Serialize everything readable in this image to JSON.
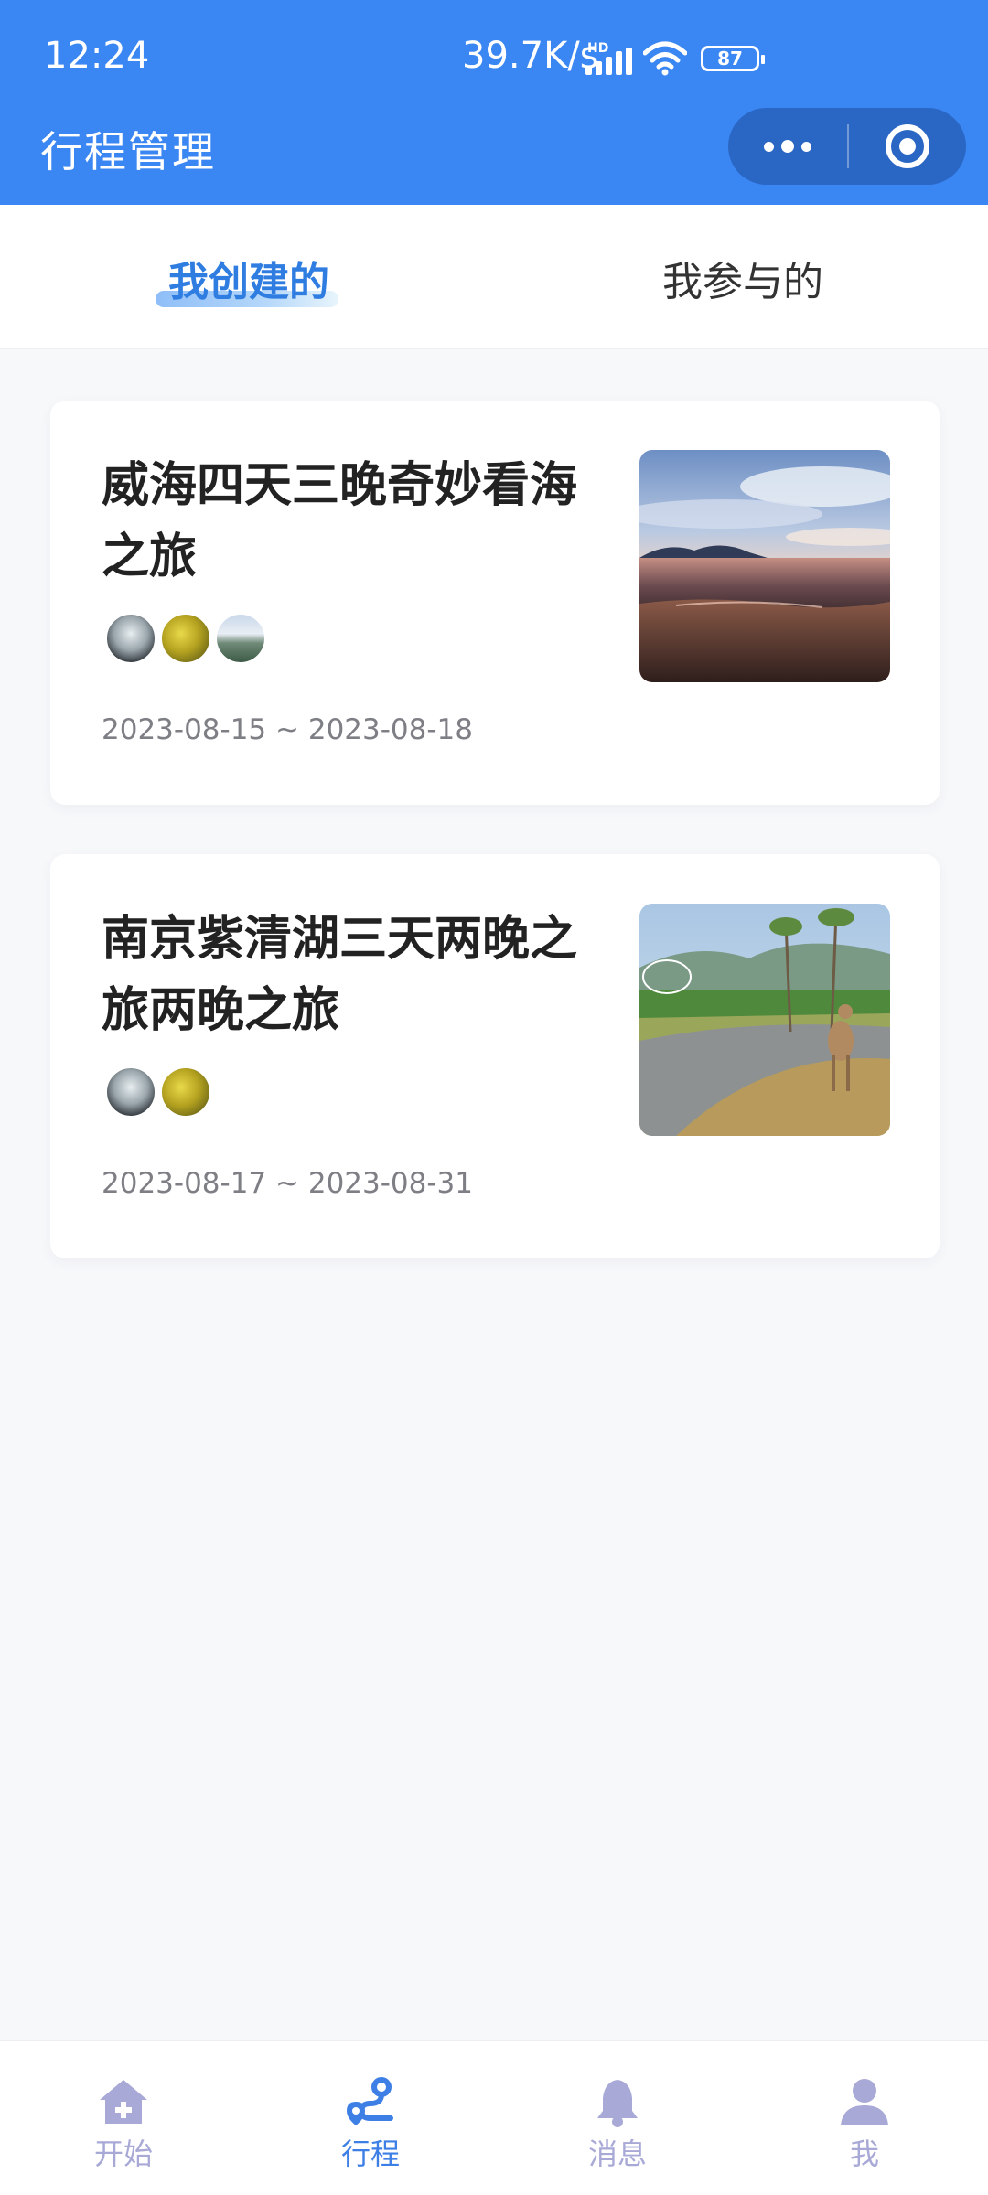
{
  "status_bar": {
    "time": "12:24",
    "net_speed": "39.7K/s",
    "network_badge": "HD",
    "battery": "87"
  },
  "header": {
    "title": "行程管理",
    "brand_color": "#3a86f2"
  },
  "tabs": [
    {
      "label": "我创建的",
      "active": true
    },
    {
      "label": "我参与的",
      "active": false
    }
  ],
  "trips": [
    {
      "title": "威海四天三晚奇妙看海之旅",
      "date_range": "2023-08-15 ~ 2023-08-18",
      "participant_count": 3,
      "cover": "seaside-sunset-photo"
    },
    {
      "title": "南京紫清湖三天两晚之旅两晚之旅",
      "date_range": "2023-08-17 ~ 2023-08-31",
      "participant_count": 2,
      "cover": "deer-park-path-photo"
    }
  ],
  "tabbar": {
    "items": [
      {
        "label": "开始",
        "icon": "home-plus-icon",
        "active": false
      },
      {
        "label": "行程",
        "icon": "route-icon",
        "active": true
      },
      {
        "label": "消息",
        "icon": "bell-icon",
        "active": false
      },
      {
        "label": "我",
        "icon": "user-icon",
        "active": false
      }
    ],
    "active_color": "#3e7fe6",
    "inactive_color": "#a8a9d6"
  }
}
